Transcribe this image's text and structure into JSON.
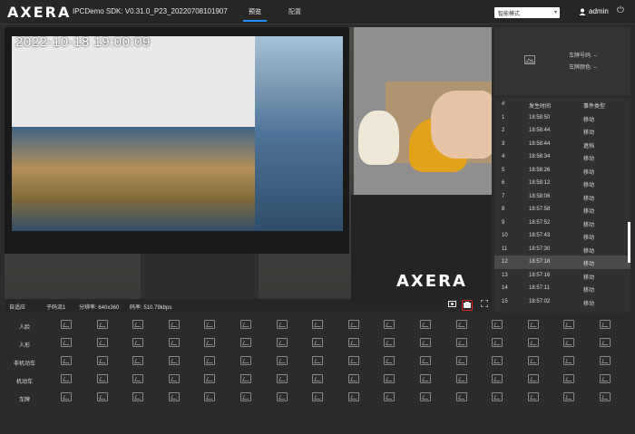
{
  "header": {
    "logo": "AXERA",
    "sdk_version": "IPCDemo SDK: V0.31.0_P23_20220708101907",
    "nav": [
      {
        "label": "预览",
        "active": true
      },
      {
        "label": "配置",
        "active": false
      }
    ],
    "mode_select": "智能模式",
    "user": "admin"
  },
  "video": {
    "timestamp": "2022-10-18 19:00:09",
    "watermark": "AXERA",
    "info": {
      "adaptive": "自适应",
      "substream": "子码流1",
      "resolution": "分辨率: 640x360",
      "bitrate": "码率: 510.79kbps"
    },
    "controls": [
      "camera-icon",
      "record-icon",
      "fullscreen-icon"
    ]
  },
  "plate_panel": {
    "plate_number": "车牌号码: --",
    "plate_color": "车牌颜色: --"
  },
  "events": {
    "headers": [
      "#",
      "发生时间",
      "事件类型"
    ],
    "rows": [
      {
        "id": "1",
        "time": "18:58:50",
        "type": "移动"
      },
      {
        "id": "2",
        "time": "18:58:44",
        "type": "移动"
      },
      {
        "id": "3",
        "time": "18:58:44",
        "type": "遮挡"
      },
      {
        "id": "4",
        "time": "18:58:34",
        "type": "移动"
      },
      {
        "id": "5",
        "time": "18:58:26",
        "type": "移动"
      },
      {
        "id": "6",
        "time": "18:58:12",
        "type": "移动"
      },
      {
        "id": "7",
        "time": "18:58:06",
        "type": "移动"
      },
      {
        "id": "8",
        "time": "18:57:58",
        "type": "移动"
      },
      {
        "id": "9",
        "time": "18:57:52",
        "type": "移动"
      },
      {
        "id": "10",
        "time": "18:57:43",
        "type": "移动"
      },
      {
        "id": "11",
        "time": "18:57:30",
        "type": "移动"
      },
      {
        "id": "12",
        "time": "18:57:18",
        "type": "移动"
      },
      {
        "id": "13",
        "time": "18:57:16",
        "type": "移动"
      },
      {
        "id": "14",
        "time": "18:57:11",
        "type": "移动"
      },
      {
        "id": "15",
        "time": "18:57:02",
        "type": "移动"
      }
    ],
    "selected_row": "12"
  },
  "capture_grid": {
    "rows": [
      "人脸",
      "人形",
      "非机动车",
      "机动车",
      "车牌"
    ],
    "thumbs_per_row": 16
  }
}
